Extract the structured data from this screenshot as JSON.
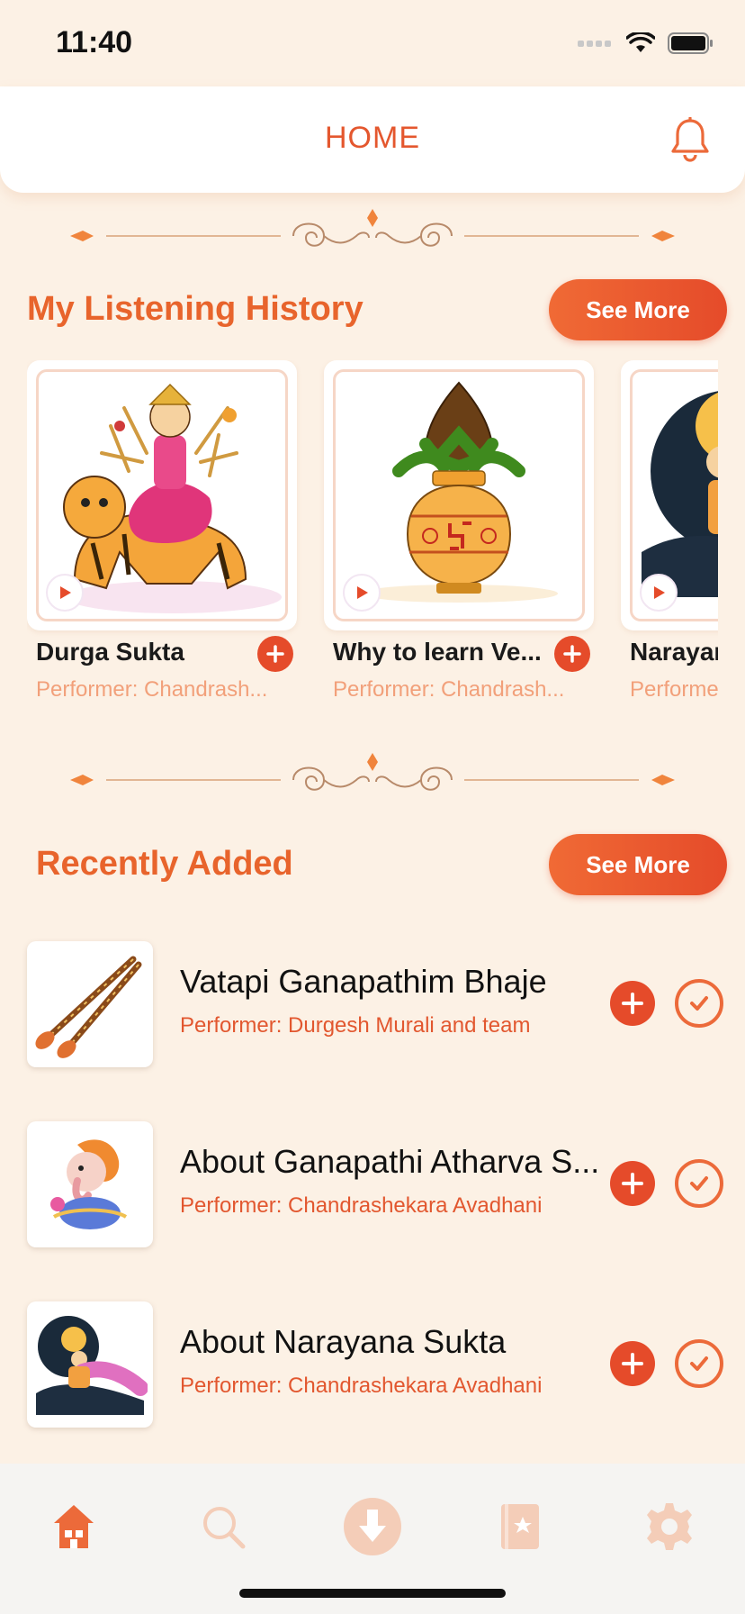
{
  "status": {
    "time": "11:40"
  },
  "header": {
    "title": "HOME"
  },
  "history": {
    "title": "My Listening History",
    "see_more": "See More",
    "items": [
      {
        "title": "Durga Sukta",
        "performer": "Performer: Chandrash..."
      },
      {
        "title": "Why to learn Ve...",
        "performer": "Performer: Chandrash..."
      },
      {
        "title": "Narayana",
        "performer": "Performer: Chandrashekara Avadhani"
      }
    ]
  },
  "recent": {
    "title": "Recently Added",
    "see_more": "See More",
    "items": [
      {
        "title": "Vatapi Ganapathim Bhaje",
        "performer": "Performer: Durgesh Murali and team"
      },
      {
        "title": "About Ganapathi Atharva S...",
        "performer": "Performer: Chandrashekara Avadhani"
      },
      {
        "title": "About Narayana Sukta",
        "performer": "Performer: Chandrashekara Avadhani"
      }
    ]
  },
  "colors": {
    "accent": "#e54b2a",
    "section_title": "#e8642c",
    "background": "#fcf1e5",
    "performer_light": "#f2a07a"
  },
  "tabs": [
    {
      "icon": "home-icon",
      "active": true
    },
    {
      "icon": "search-icon",
      "active": false
    },
    {
      "icon": "download-icon",
      "active": false
    },
    {
      "icon": "library-icon",
      "active": false
    },
    {
      "icon": "settings-icon",
      "active": false
    }
  ]
}
